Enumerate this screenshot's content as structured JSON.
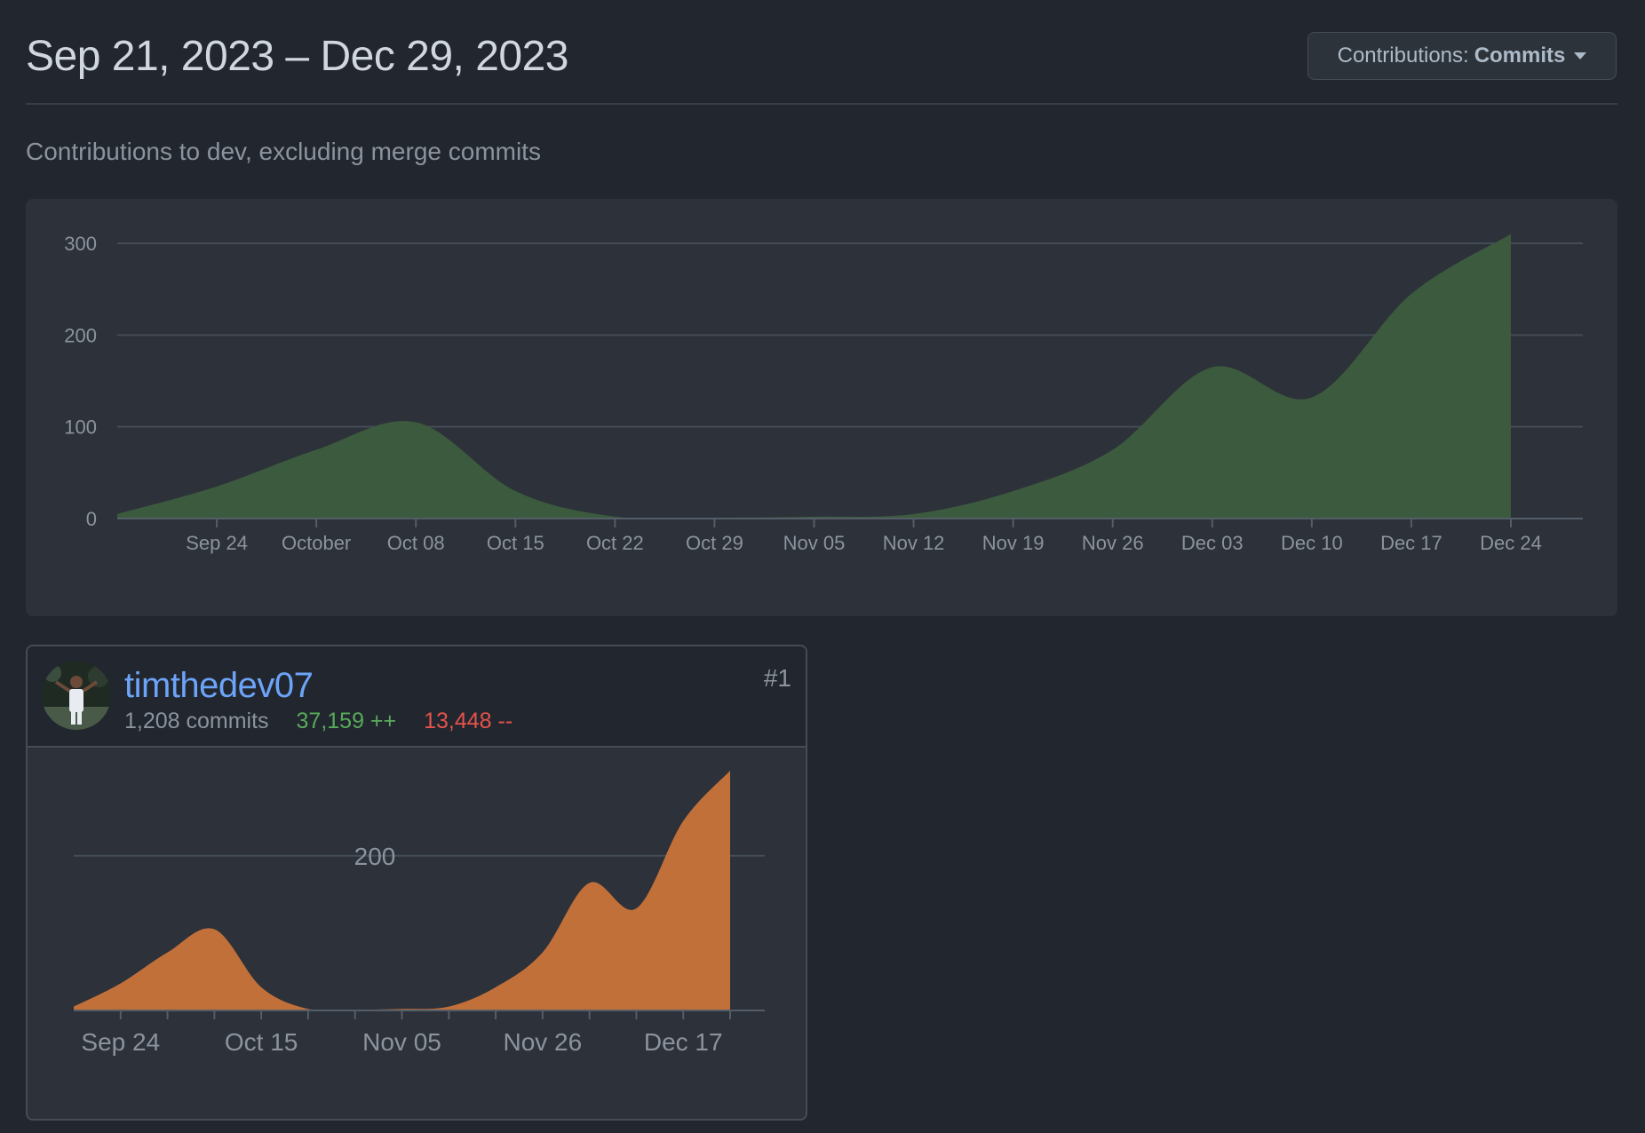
{
  "header": {
    "date_range": "Sep 21, 2023 – Dec 29, 2023",
    "dropdown_label": "Contributions:",
    "dropdown_value": "Commits"
  },
  "subtitle": "Contributions to dev, excluding merge commits",
  "colors": {
    "main_fill": "#3b5a3e",
    "contributor_fill": "#c2703a",
    "link": "#6ca4f8",
    "additions": "#57ab5a",
    "deletions": "#e5534b"
  },
  "chart_data": [
    {
      "type": "area",
      "title": "",
      "xlabel": "",
      "ylabel": "",
      "ylim": [
        0,
        300
      ],
      "y_ticks": [
        0,
        100,
        200,
        300
      ],
      "x_ticks": [
        "Sep 24",
        "October",
        "Oct 08",
        "Oct 15",
        "Oct 22",
        "Oct 29",
        "Nov 05",
        "Nov 12",
        "Nov 19",
        "Nov 26",
        "Dec 03",
        "Dec 10",
        "Dec 17",
        "Dec 24"
      ],
      "x": [
        "2023-09-17",
        "2023-09-24",
        "2023-10-01",
        "2023-10-08",
        "2023-10-15",
        "2023-10-22",
        "2023-10-29",
        "2023-11-05",
        "2023-11-12",
        "2023-11-19",
        "2023-11-26",
        "2023-12-03",
        "2023-12-10",
        "2023-12-17",
        "2023-12-24"
      ],
      "values": [
        5,
        35,
        75,
        105,
        30,
        2,
        1,
        2,
        5,
        30,
        75,
        165,
        132,
        245,
        310
      ],
      "grid": true,
      "series": [
        {
          "values": [
            5,
            35,
            75,
            105,
            30,
            2,
            1,
            2,
            5,
            30,
            75,
            165,
            132,
            245,
            310
          ]
        }
      ]
    },
    {
      "type": "area",
      "title": "",
      "xlabel": "",
      "ylabel": "",
      "ylim": [
        0,
        310
      ],
      "y_ticks": [
        200
      ],
      "x_ticks": [
        "Sep 24",
        "Oct 15",
        "Nov 05",
        "Nov 26",
        "Dec 17"
      ],
      "x": [
        "2023-09-17",
        "2023-09-24",
        "2023-10-01",
        "2023-10-08",
        "2023-10-15",
        "2023-10-22",
        "2023-10-29",
        "2023-11-05",
        "2023-11-12",
        "2023-11-19",
        "2023-11-26",
        "2023-12-03",
        "2023-12-10",
        "2023-12-17",
        "2023-12-24"
      ],
      "values": [
        5,
        35,
        75,
        105,
        30,
        2,
        1,
        2,
        5,
        30,
        75,
        165,
        132,
        245,
        310
      ],
      "grid": true,
      "series": [
        {
          "values": [
            5,
            35,
            75,
            105,
            30,
            2,
            1,
            2,
            5,
            30,
            75,
            165,
            132,
            245,
            310
          ]
        }
      ]
    }
  ],
  "contributor": {
    "username": "timthedev07",
    "rank": "#1",
    "commits": "1,208 commits",
    "additions": "37,159 ++",
    "deletions": "13,448 --"
  }
}
